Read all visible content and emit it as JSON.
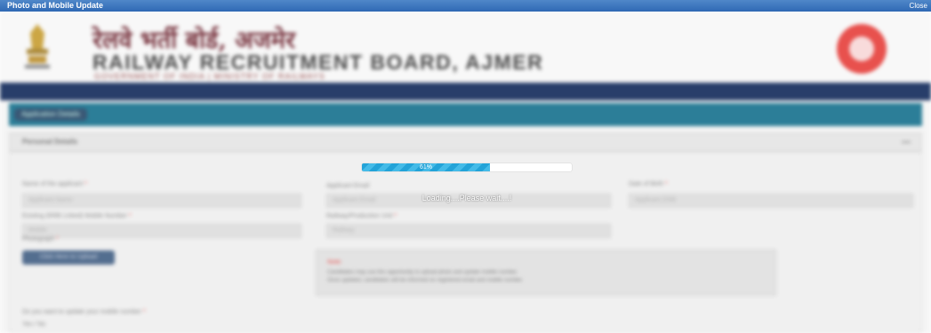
{
  "window": {
    "title": "Photo and Mobile Update",
    "close_label": "Close"
  },
  "header": {
    "hindi_title": "रेलवे भर्ती बोर्ड, अजमेर",
    "english_title": "RAILWAY RECRUITMENT BOARD, AJMER",
    "subtitle": "GOVERNMENT OF INDIA | MINISTRY OF RAILWAYS"
  },
  "tabs": {
    "application_details": "Application Details"
  },
  "section": {
    "title": "Personal Details"
  },
  "form": {
    "name_label": "Name of the applicant",
    "name_placeholder": "Applicant Name",
    "email_label": "Applicant Email",
    "email_placeholder": "Applicant Email",
    "dob_label": "Date of Birth",
    "dob_placeholder": "Applicant DOB",
    "mobile_label": "Existing (RRB Linked) Mobile Number",
    "mobile_placeholder": "Mobile",
    "railway_label": "Railway/Production Unit",
    "railway_placeholder": "Railway",
    "photo_label": "Photograph",
    "upload_button": "Click Here to Upload",
    "update_question": "Do you want to update your mobile number",
    "radio_options": "Yes / No"
  },
  "note": {
    "title": "Note:",
    "line1": "Candidates may use this opportunity to upload photo and update mobile number.",
    "line2": "Once updated, candidates will be informed on registered email and mobile number."
  },
  "progress": {
    "percent": 61,
    "label": "61%"
  },
  "loading_text": "Loading....Please wait....!"
}
